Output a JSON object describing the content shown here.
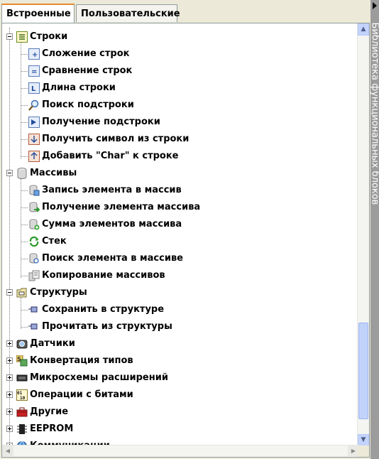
{
  "tabs": {
    "builtin": "Встроенные",
    "custom": "Пользовательские"
  },
  "sidebar": {
    "title": "Библиотека функциональных блоков"
  },
  "tree": {
    "strings": {
      "label": "Строки",
      "items": [
        "Сложение строк",
        "Сравнение строк",
        "Длина строки",
        "Поиск подстроки",
        "Получение подстроки",
        "Получить символ из строки",
        "Добавить \"Char\" к строке"
      ]
    },
    "arrays": {
      "label": "Массивы",
      "items": [
        "Запись элемента в массив",
        "Получение элемента массива",
        "Сумма элементов массива",
        "Стек",
        "Поиск элемента в массиве",
        "Копирование массивов"
      ]
    },
    "structs": {
      "label": "Структуры",
      "items": [
        "Сохранить в структуре",
        "Прочитать из структуры"
      ]
    },
    "collapsed": [
      "Датчики",
      "Конвертация типов",
      "Микросхемы расширений",
      "Операции с битами",
      "Другие",
      "EEPROM",
      "Коммуникации"
    ]
  },
  "colors": {
    "tab_accent": "#e68b2c",
    "scroll": "#c1d3fb",
    "sidebar": "#9c9c9c"
  }
}
